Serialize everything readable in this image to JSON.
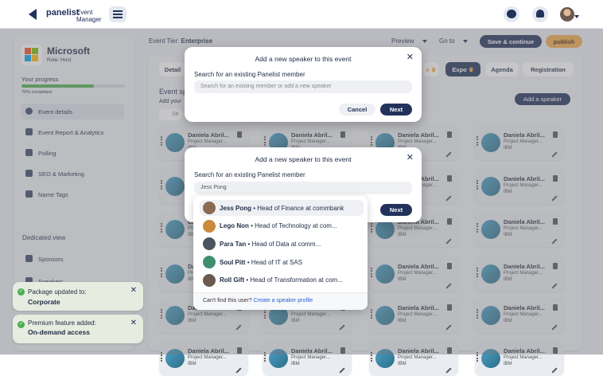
{
  "brand": {
    "name": "panelist",
    "subtitle_1": "Event",
    "subtitle_2": "Manager"
  },
  "org": {
    "name": "Microsoft",
    "role": "Role: Host"
  },
  "progress": {
    "label": "Your progress",
    "value": 0.7,
    "text": "70% completed"
  },
  "sidebar": {
    "items": [
      {
        "label": "Event details",
        "icon": "info-icon",
        "active": true
      },
      {
        "label": "Event Report & Analytics",
        "icon": "analytics-icon"
      },
      {
        "label": "Polling",
        "icon": "polling-icon"
      },
      {
        "label": "SEO & Marketing",
        "icon": "seo-icon"
      },
      {
        "label": "Name Tags",
        "icon": "name-tag-icon"
      }
    ],
    "dedicated_label": "Dedicated view",
    "dedicated_items": [
      {
        "label": "Sponsors",
        "icon": "sponsors-icon"
      },
      {
        "label": "Speakers",
        "icon": "speakers-icon"
      }
    ]
  },
  "toasts": [
    {
      "title": "Package updated to:",
      "value": "Corporate"
    },
    {
      "title": "Premium feature added:",
      "value": "On-demand access"
    }
  ],
  "header": {
    "tier_label": "Event Tier:",
    "tier_value": "Enterprise",
    "preview": "Preview",
    "goto": "Go to",
    "save": "Save & continue",
    "publish": "publish"
  },
  "tabs": {
    "details": "Detail",
    "expo": "Expo",
    "agenda": "Agenda",
    "registration": "Registration"
  },
  "speakers_section": {
    "title": "Event sp",
    "subtitle": "Add your",
    "search_placeholder": "Se",
    "add_button": "Add a speaker"
  },
  "speaker_card": {
    "name": "Daniela Abril...",
    "role": "Project Manager...",
    "company": "IBM"
  },
  "modal1": {
    "title": "Add a new speaker to this event",
    "label": "Search for an existing Panelist member",
    "placeholder": "Search for an existing member or add a new speaker",
    "cancel": "Cancel",
    "next": "Next"
  },
  "modal2": {
    "title": "Add a new speaker to this event",
    "label": "Search for an existing Panelist member",
    "value": "Jess Pong",
    "next": "Next"
  },
  "dropdown": {
    "results": [
      {
        "name": "Jess Pong",
        "desc": "• Head of Finance at commbank",
        "highlighted": true,
        "color": "#8a6a52"
      },
      {
        "name": "Lego Non",
        "desc": "• Head of Technology at com...",
        "color": "#c98a3a"
      },
      {
        "name": "Para Tan",
        "desc": "• Head of Data at comm...",
        "color": "#4a5560"
      },
      {
        "name": "Soul Pitt",
        "desc": "• Head of IT at SAS",
        "color": "#3f8f6e"
      },
      {
        "name": "Roll Gift",
        "desc": "• Head of Transformation at com...",
        "color": "#6b5a4e"
      }
    ],
    "footer_text": "Can't find this user?",
    "footer_link": "Create a speaker profile"
  },
  "colors": {
    "navy": "#23325a",
    "green": "#4caf50",
    "orange": "#f0a94a",
    "bg": "#eaedf2"
  }
}
